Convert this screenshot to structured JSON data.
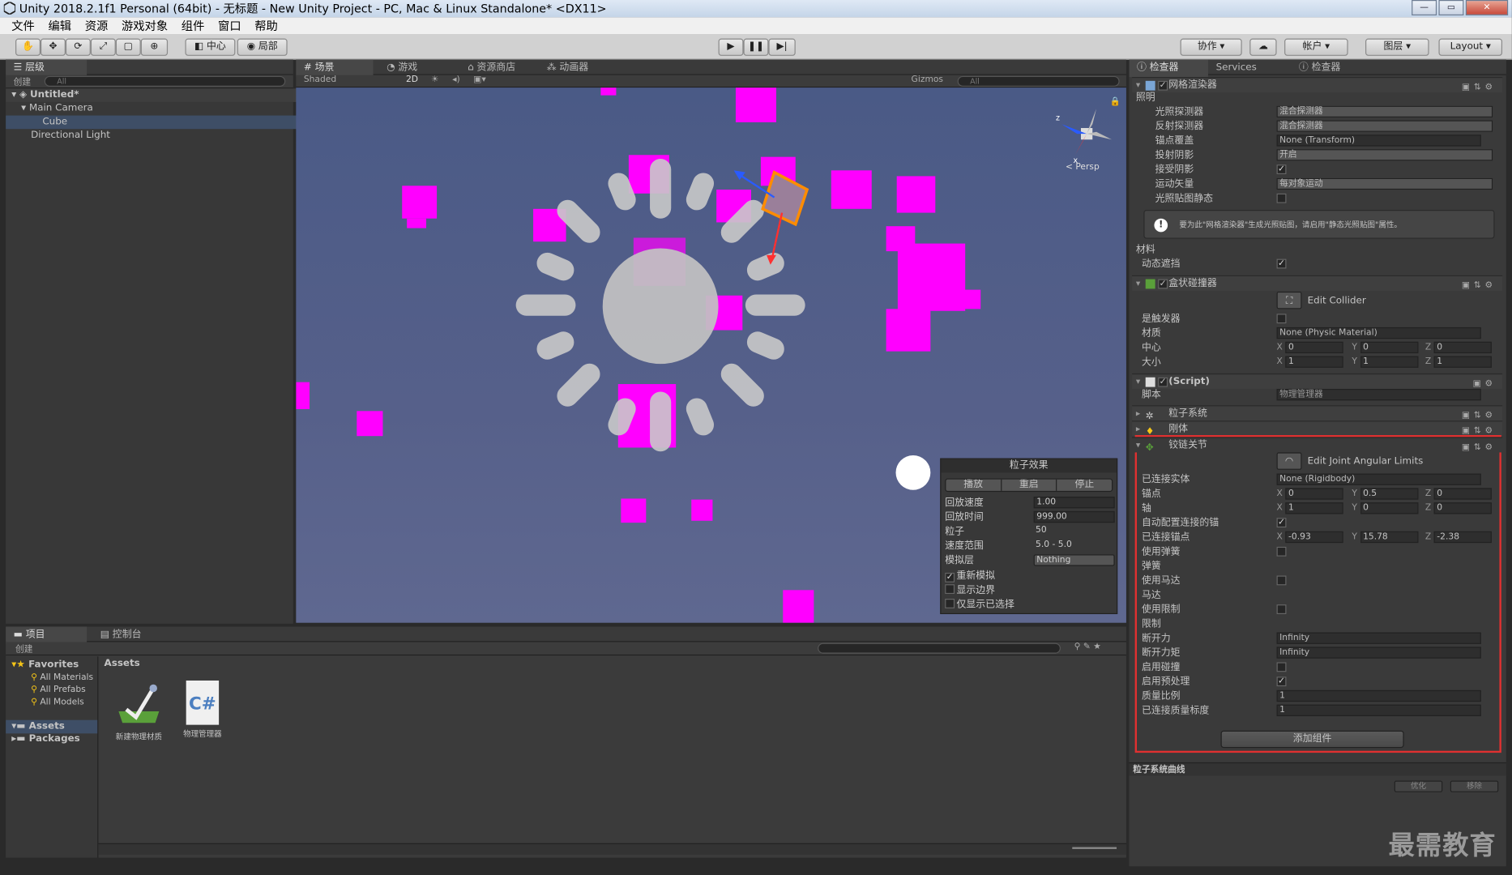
{
  "window": {
    "title": "Unity 2018.2.1f1 Personal (64bit) - 无标题 - New Unity Project - PC, Mac & Linux Standalone* <DX11>",
    "min": "—",
    "max": "▭",
    "close": "✕"
  },
  "menu": [
    "文件",
    "编辑",
    "资源",
    "游戏对象",
    "组件",
    "窗口",
    "帮助"
  ],
  "toolbar": {
    "pivot": "中心",
    "space": "局部",
    "collab": "协作",
    "account": "帐户",
    "layers": "图层",
    "layout": "Layout",
    "tools": [
      "✋",
      "✥",
      "⟳",
      "⤢",
      "▢",
      "⊕"
    ],
    "play": "▶",
    "pause": "❚❚",
    "step": "▶|",
    "cloud": "☁"
  },
  "hierarchy": {
    "tab": "层级",
    "create": "创建",
    "search": "All",
    "scene": "Untitled*",
    "items": [
      "Main Camera",
      "Cube",
      "Directional Light"
    ]
  },
  "sceneview": {
    "tabs": [
      "场景",
      "游戏",
      "资源商店",
      "动画器"
    ],
    "shading": "Shaded",
    "mode2d": "2D",
    "gizmos": "Gizmos",
    "search": "All",
    "persp": "< Persp"
  },
  "particle_effect": {
    "title": "粒子效果",
    "buttons": [
      "播放",
      "重启",
      "停止"
    ],
    "rows": [
      {
        "label": "回放速度",
        "value": "1.00"
      },
      {
        "label": "回放时间",
        "value": "999.00"
      },
      {
        "label": "粒子",
        "value": "50"
      },
      {
        "label": "速度范围",
        "value": "5.0 - 5.0"
      },
      {
        "label": "模拟层",
        "value": "Nothing"
      }
    ],
    "checks": [
      {
        "label": "重新模拟",
        "checked": true
      },
      {
        "label": "显示边界",
        "checked": false
      },
      {
        "label": "仅显示已选择",
        "checked": false
      }
    ]
  },
  "project": {
    "tabs": [
      "项目",
      "控制台"
    ],
    "create": "创建",
    "favorites": "Favorites",
    "fav_items": [
      "All Materials",
      "All Prefabs",
      "All Models"
    ],
    "assets_tree": "Assets",
    "packages": "Packages",
    "assets_header": "Assets",
    "assets": [
      {
        "name": "新建物理材质"
      },
      {
        "name": "物理管理器",
        "glyph": "C#"
      }
    ]
  },
  "inspector": {
    "tabs": [
      "检查器",
      "Services",
      "检查器"
    ],
    "mesh_renderer": {
      "title": "网格渲染器",
      "lighting": "照明",
      "rows": [
        {
          "label": "光照探测器",
          "value": "混合探测器"
        },
        {
          "label": "反射探测器",
          "value": "混合探测器"
        },
        {
          "label": "锚点覆盖",
          "value": "None (Transform)"
        },
        {
          "label": "投射阴影",
          "value": "开启"
        },
        {
          "label": "接受阴影",
          "check": true
        },
        {
          "label": "运动矢量",
          "value": "每对象运动"
        },
        {
          "label": "光照贴图静态",
          "check": false
        }
      ],
      "info": "要为此\"网格渲染器\"生成光照贴图，请启用\"静态光照贴图\"属性。",
      "materials": "材料",
      "dynamic_occlusion": "动态遮挡"
    },
    "box_collider": {
      "title": "盒状碰撞器",
      "edit": "Edit Collider",
      "is_trigger": "是触发器",
      "material_label": "材质",
      "material": "None (Physic Material)",
      "center_label": "中心",
      "center": [
        "0",
        "0",
        "0"
      ],
      "size_label": "大小",
      "size": [
        "1",
        "1",
        "1"
      ]
    },
    "script": {
      "title": "(Script)",
      "label": "脚本",
      "value": "物理管理器"
    },
    "particle_system": "粒子系统",
    "rigidbody": "刚体",
    "hinge": {
      "title": "铰链关节",
      "edit": "Edit Joint Angular Limits",
      "connected_body_label": "已连接实体",
      "connected_body": "None (Rigidbody)",
      "anchor_label": "锚点",
      "anchor": [
        "0",
        "0.5",
        "0"
      ],
      "axis_label": "轴",
      "axis": [
        "1",
        "0",
        "0"
      ],
      "auto_config": "自动配置连接的锚",
      "connected_anchor_label": "已连接锚点",
      "connected_anchor": [
        "-0.93",
        "15.78",
        "-2.38"
      ],
      "use_spring": "使用弹簧",
      "spring": "弹簧",
      "use_motor": "使用马达",
      "motor": "马达",
      "use_limits": "使用限制",
      "limits": "限制",
      "break_force_label": "断开力",
      "break_force": "Infinity",
      "break_torque_label": "断开力矩",
      "break_torque": "Infinity",
      "enable_collision": "启用碰撞",
      "enable_preprocessing": "启用预处理",
      "mass_scale_label": "质量比例",
      "mass_scale": "1",
      "connected_mass_scale_label": "已连接质量标度",
      "connected_mass_scale": "1"
    },
    "add_component": "添加组件",
    "curves": "粒子系统曲线",
    "optimize": "优化",
    "remove": "移除"
  },
  "watermark": "最需教育",
  "colors": {
    "accent": "#ff00ff",
    "highlight": "#e03030",
    "selection": "#3e4e66"
  }
}
